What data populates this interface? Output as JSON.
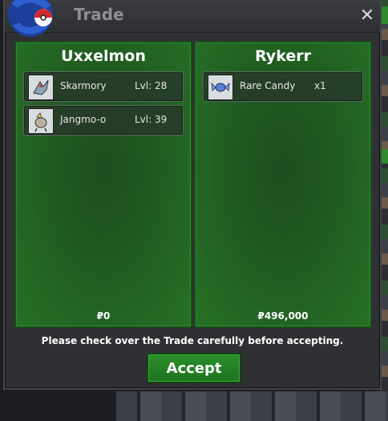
{
  "dialog": {
    "title": "Trade",
    "close_label": "✕"
  },
  "left_panel": {
    "player": "Uxxelmon",
    "items": [
      {
        "name": "Skarmory",
        "extra": "Lvl: 28",
        "icon": "skarmory-sprite-icon"
      },
      {
        "name": "Jangmo-o",
        "extra": "Lvl: 39",
        "icon": "jangmo-o-sprite-icon"
      }
    ],
    "money": "₽0"
  },
  "right_panel": {
    "player": "Rykerr",
    "items": [
      {
        "name": "Rare Candy",
        "extra": "x1",
        "icon": "rare-candy-icon"
      }
    ],
    "money": "₽496,000"
  },
  "notice": "Please check over the Trade carefully before accepting.",
  "accept_label": "Accept",
  "colors": {
    "panel_green": "#205a21",
    "accept_green": "#2a8f2a",
    "title_gray": "#8e9096"
  }
}
